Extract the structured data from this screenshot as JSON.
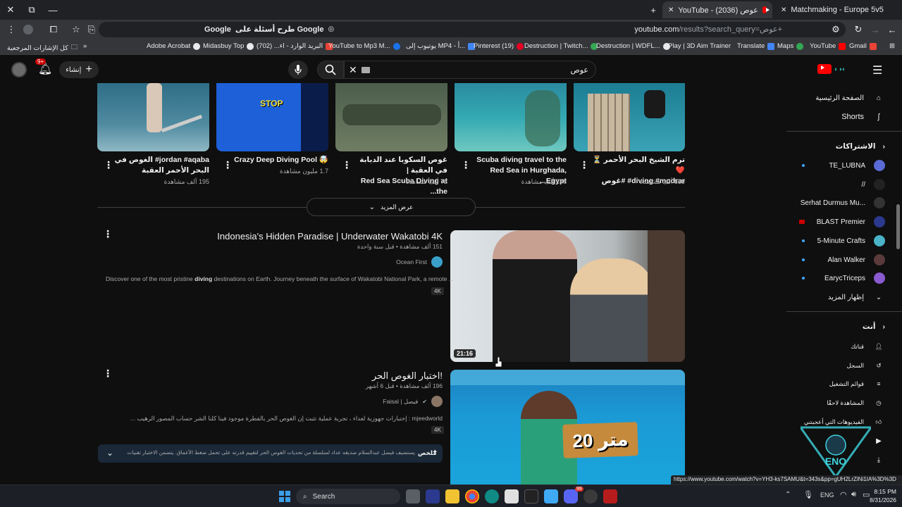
{
  "browser": {
    "tabs": [
      {
        "title": "Matchmaking - Europe 5v5 Qu"
      },
      {
        "title": "YouTube - عوص (2036)"
      }
    ],
    "url": "youtube.com",
    "url_path": "/results?search_query=عوص+",
    "google_chip": "طرح أسئلة على Google",
    "bookmarks": [
      {
        "label": "Gmail",
        "color": "#ea4335"
      },
      {
        "label": "YouTube",
        "color": "#ff0000"
      },
      {
        "label": "Maps",
        "color": "#34a853"
      },
      {
        "label": "Translate",
        "color": "#4285f4"
      },
      {
        "label": "Play | 3D Aim Trainer",
        "color": "#e8eaed"
      },
      {
        "label": "Destruction | WDFL...",
        "color": "#e8eaed"
      },
      {
        "label": "Destruction | Twitch...",
        "color": "#34a853"
      },
      {
        "label": "Pinterest (19)",
        "color": "#e60023"
      },
      {
        "label": "يوتيوب إلى MP4 - أ...",
        "color": "#4285f4"
      },
      {
        "label": "YouTube to Mp3 M...",
        "color": "#1a73e8"
      },
      {
        "label": "البريد الوارد - اء... (702)",
        "color": "#ea4335"
      },
      {
        "label": "Midasbuy Top",
        "color": "#e8eaed"
      },
      {
        "label": "Adobe Acrobat",
        "color": "#e8eaed"
      }
    ],
    "all_bookmarks": "كل الإشارات المرجعية"
  },
  "youtube": {
    "search_value": "عوص",
    "create_label": "إنشاء",
    "notif_count": "9+",
    "shorts": [
      {
        "title1": "ترم الشيخ البحر الأحمر ⏳ ❤️",
        "title2": "diving #modrar# #غوص",
        "views": "559 ألف مشاهدة"
      },
      {
        "title1": "Scuba diving travel to the",
        "title2": "Red Sea in Hurghada, Egypt...",
        "views": "248 ألف مشاهدة"
      },
      {
        "title1": "غوص السكوبا عند الدبابة في العقبة |",
        "title2": "Red Sea Scuba Diving at the...",
        "views": "73 ألف مشاهدة"
      },
      {
        "title1": "🤯 Crazy Deep Diving Pool",
        "title2": "",
        "views": "1.7 مليون مشاهدة"
      },
      {
        "title1": "jordan #aqaba# الغوص في",
        "title2": "البحر الأحمر العقبة",
        "views": "195 ألف مشاهدة"
      }
    ],
    "show_more": "عرض المزيد",
    "short_overlay": "STOP",
    "videos": [
      {
        "title": "Indonesia's Hidden Paradise | Underwater Wakatobi 4K",
        "meta": "151 ألف مشاهدة • قبل سنة واحدة",
        "channel": "Ocean First",
        "desc_pre": "Discover one of the most pristine ",
        "desc_bold": "diving",
        "desc_post": " destinations on Earth. Journey beneath the surface of Wakatobi National Park, a remote ...",
        "badge": "4K",
        "duration": "21:16"
      },
      {
        "title": "اختبار الغوص الحر!",
        "meta": "196 ألف مشاهدة • قبل 6 أشهر",
        "channel": "Faisal | فيصل",
        "desc": "mjeedworld : إختبارات جهوزية لعداء ، تجربة عملية تثبت إن الغوص الحر بالفطرة موجود فينا كلنا الشر حساب المصور الرهيب ...",
        "badge": "4K",
        "thumb_text": "20 متر"
      }
    ],
    "summary_label": "ملخص",
    "summary_text": "يستضيف فيصل عبدالسلام صديقه عداد لسلسلة من تحديات الغوص الحر لتقييم قدرته على تحمل ضغط الأعماق. يتضمن الاختبار تقنيات حبس النفس ومعادلة ضغط..."
  },
  "sidebar": {
    "home": "الصفحة الرئيسية",
    "shorts": "Shorts",
    "subs_header": "الاشتراكات",
    "subs": [
      {
        "name": "TE_LUBNA",
        "color": "#5b6bd5",
        "dot": true
      },
      {
        "name": "//",
        "color": "#222",
        "dot": false
      },
      {
        "name": "Serhat Durmus Mu...",
        "color": "#333",
        "dot": false
      },
      {
        "name": "BLAST Premier",
        "color": "#2b3a8f",
        "dot": false,
        "live": true
      },
      {
        "name": "5-Minute Crafts",
        "color": "#4ab3c8",
        "dot": true
      },
      {
        "name": "Alan Walker",
        "color": "#5a3a3a",
        "dot": true
      },
      {
        "name": "EarycTriceps",
        "color": "#8a5ad0",
        "dot": true
      }
    ],
    "show_more": "إظهار المزيد",
    "you_header": "أنت",
    "you_items": [
      "قناتك",
      "السجل",
      "قوائم التشغيل",
      "المشاهدة لاحقًا",
      "الفيديوهات التي أعجبتني",
      "",
      ""
    ]
  },
  "status_url": "https://www.youtube.com/watch?v=YH3-ks7SAMU&t=343s&pp=gUH2LrZiNi1IA%3D%3D",
  "watermark": "ENO GAMING",
  "taskbar": {
    "search": "Search",
    "lang": "ENG",
    "time": "8:15 PM",
    "date": "8/31/2026",
    "discord_badge": "99"
  }
}
